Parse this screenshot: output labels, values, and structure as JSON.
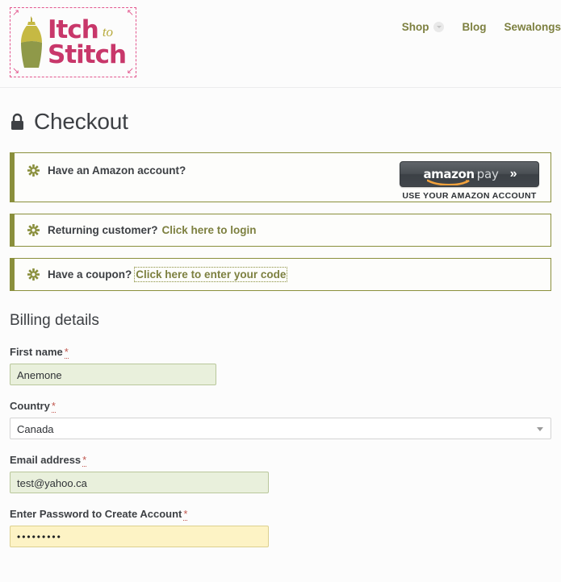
{
  "header": {
    "logo": {
      "line1": "Itch",
      "script": "to",
      "line2": "Stitch",
      "alt": "Itch to Stitch"
    },
    "nav": [
      {
        "label": "Shop",
        "has_dropdown": true
      },
      {
        "label": "Blog",
        "has_dropdown": false
      },
      {
        "label": "Sewalongs",
        "has_dropdown": false
      }
    ]
  },
  "page": {
    "title": "Checkout"
  },
  "notices": {
    "amazon": {
      "text": "Have an Amazon account?",
      "button_amazon": "amazon",
      "button_pay": "pay",
      "button_chevron": "»",
      "subtitle": "USE YOUR AMAZON ACCOUNT"
    },
    "login": {
      "text": "Returning customer?",
      "link": "Click here to login"
    },
    "coupon": {
      "text": "Have a coupon?",
      "link": "Click here to enter your code"
    }
  },
  "billing": {
    "section_title": "Billing details",
    "required_mark": "*",
    "fields": {
      "first_name": {
        "label": "First name",
        "value": "Anemone",
        "placeholder": ""
      },
      "country": {
        "label": "Country",
        "value": "Canada"
      },
      "email": {
        "label": "Email address",
        "value": "test@yahoo.ca",
        "placeholder": ""
      },
      "password": {
        "label": "Enter Password to Create Account",
        "value": "•••••••••",
        "placeholder": ""
      }
    }
  },
  "colors": {
    "brand_pink": "#c8376a",
    "brand_olive": "#7d8040",
    "notice_border": "#8a8f3c",
    "valid_field_bg": "#e9f0dc",
    "autofill_bg": "#fdf3c5",
    "required_red": "#c1584f",
    "text_dark": "#3d4044"
  }
}
